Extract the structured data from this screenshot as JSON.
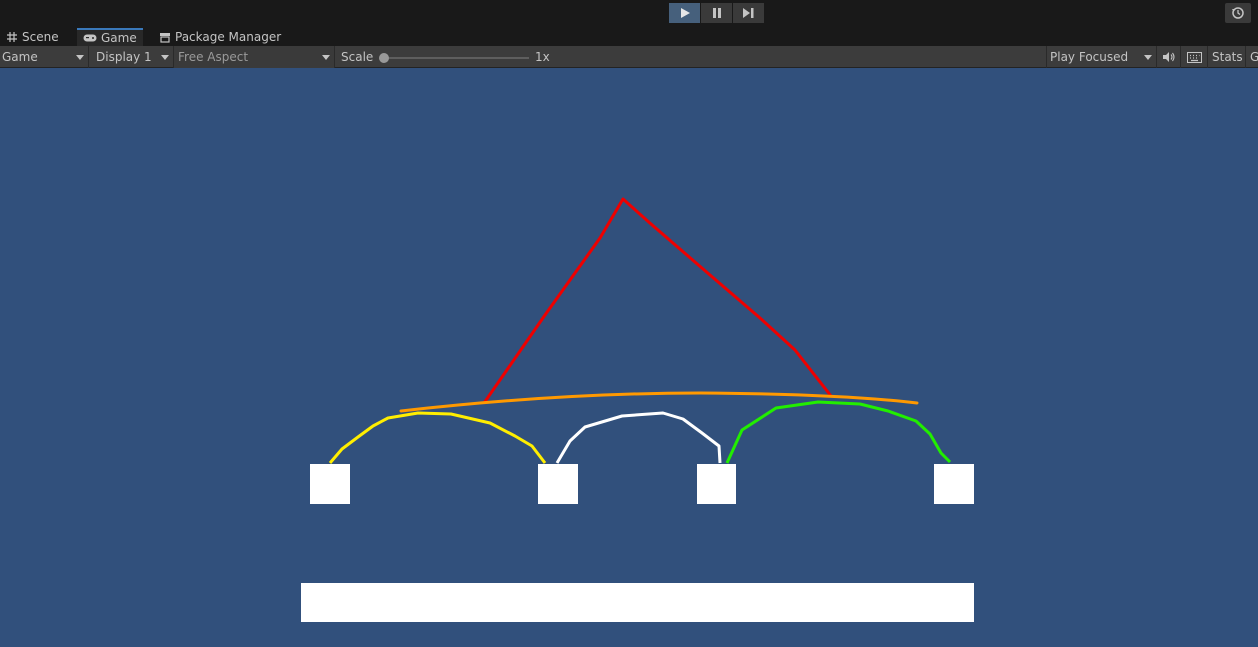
{
  "playbar": {
    "buttons": [
      {
        "name": "play",
        "active": true
      },
      {
        "name": "pause",
        "active": false
      },
      {
        "name": "step",
        "active": false
      }
    ]
  },
  "tabs": [
    {
      "label": "Scene",
      "icon": "grid-icon",
      "active": false
    },
    {
      "label": "Game",
      "icon": "gamepad-icon",
      "active": true
    },
    {
      "label": "Package Manager",
      "icon": "package-icon",
      "active": false
    }
  ],
  "toolbar": {
    "view_select": "Game",
    "display_select": "Display 1",
    "aspect_select": "Free Aspect",
    "scale_label": "Scale",
    "scale_value": "1x",
    "play_mode_select": "Play Focused",
    "stats_label": "Stats",
    "gizmos_label": "G"
  },
  "colors": {
    "game_background": "#31507c",
    "red_curve": "#ee0000",
    "orange_curve": "#ff9900",
    "yellow_curve": "#ffee00",
    "white_curve": "#ffffff",
    "green_curve": "#22ee00",
    "block": "#ffffff"
  }
}
